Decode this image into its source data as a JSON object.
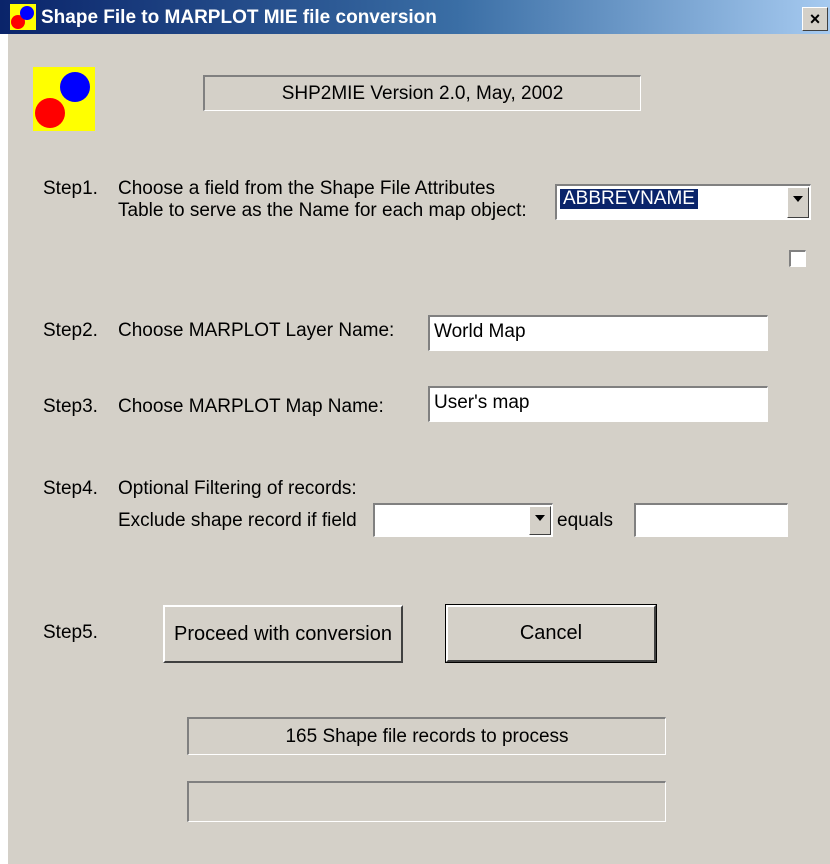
{
  "window": {
    "title": "Shape File to MARPLOT MIE file conversion",
    "close_label": "×"
  },
  "version_text": "SHP2MIE  Version 2.0,  May, 2002",
  "step1": {
    "label": "Step1.",
    "line1": "Choose a field from the Shape File Attributes",
    "line2": "Table to serve as the Name for each map object:",
    "selected": "ABBREVNAME"
  },
  "step2": {
    "label": "Step2.",
    "text": "Choose MARPLOT Layer Name:",
    "value": "World Map"
  },
  "step3": {
    "label": "Step3.",
    "text": "Choose MARPLOT Map Name:",
    "value": "User's map"
  },
  "step4": {
    "label": "Step4.",
    "line1": "Optional Filtering of records:",
    "line2": "Exclude shape record if field",
    "field_value": "",
    "equals_label": "equals",
    "equals_value": ""
  },
  "step5": {
    "label": "Step5.",
    "proceed_label": "Proceed with conversion",
    "cancel_label": "Cancel"
  },
  "status": {
    "records_text": "165 Shape file records to process",
    "progress_text": ""
  },
  "colors": {
    "title_bar": "#0a246a",
    "face": "#d4d0c8",
    "logo_bg": "#ffff00",
    "logo_red": "#ff0000",
    "logo_blue": "#0000ff"
  },
  "icons": {
    "app": "app-logo-icon",
    "dropdown": "chevron-down-icon"
  }
}
